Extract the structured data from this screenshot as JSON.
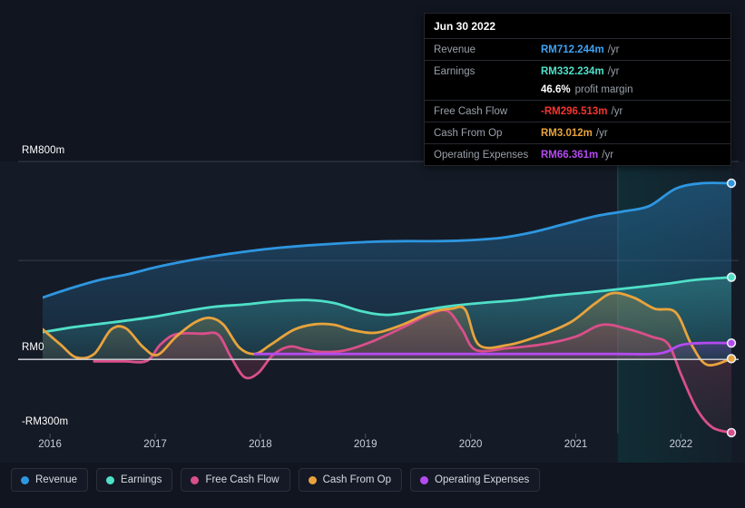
{
  "tooltip": {
    "date": "Jun 30 2022",
    "rows": [
      {
        "key": "Revenue",
        "value": "RM712.244m",
        "unit": "/yr",
        "color": "#3fa3f5"
      },
      {
        "key": "Earnings",
        "value": "RM332.234m",
        "unit": "/yr",
        "color": "#4fe0c8"
      },
      {
        "key": "",
        "value": "46.6%",
        "unit": "",
        "sub": "profit margin",
        "color": "#ffffff"
      },
      {
        "key": "Free Cash Flow",
        "value": "-RM296.513m",
        "unit": "/yr",
        "color": "#f4352e"
      },
      {
        "key": "Cash From Op",
        "value": "RM3.012m",
        "unit": "/yr",
        "color": "#e8a33d"
      },
      {
        "key": "Operating Expenses",
        "value": "RM66.361m",
        "unit": "/yr",
        "color": "#b44bf0"
      }
    ]
  },
  "legend": {
    "items": [
      {
        "label": "Revenue",
        "color": "#2e96e0"
      },
      {
        "label": "Earnings",
        "color": "#4fe0c8"
      },
      {
        "label": "Free Cash Flow",
        "color": "#d94f8a"
      },
      {
        "label": "Cash From Op",
        "color": "#e8a33d"
      },
      {
        "label": "Operating Expenses",
        "color": "#b44bf0"
      }
    ]
  },
  "chart_data": {
    "type": "area",
    "title": "",
    "xlabel": "",
    "ylabel": "",
    "currency": "RM",
    "ylim": [
      -300,
      800
    ],
    "yticks": [
      800,
      400,
      0,
      -300
    ],
    "ytick_labels": [
      "RM800m",
      "",
      "RM0",
      "-RM300m"
    ],
    "grid": true,
    "legend_position": "bottom",
    "x": [
      "2016",
      "2017",
      "2018",
      "2019",
      "2020",
      "2021",
      "2022"
    ],
    "xticks": [
      "2016",
      "2017",
      "2018",
      "2019",
      "2020",
      "2021",
      "2022"
    ],
    "forecast_from": "2021.4",
    "series": [
      {
        "name": "Revenue",
        "color": "#2e96e0",
        "fill": "rgba(38,110,160,0.55)",
        "points": [
          [
            2015.93,
            250
          ],
          [
            2016.2,
            288
          ],
          [
            2016.48,
            322
          ],
          [
            2016.75,
            345
          ],
          [
            2017.0,
            372
          ],
          [
            2017.3,
            398
          ],
          [
            2017.6,
            420
          ],
          [
            2017.9,
            438
          ],
          [
            2018.2,
            452
          ],
          [
            2018.5,
            462
          ],
          [
            2018.8,
            470
          ],
          [
            2019.1,
            476
          ],
          [
            2019.4,
            478
          ],
          [
            2019.7,
            478
          ],
          [
            2020.0,
            482
          ],
          [
            2020.3,
            492
          ],
          [
            2020.6,
            515
          ],
          [
            2020.9,
            548
          ],
          [
            2021.2,
            580
          ],
          [
            2021.45,
            598
          ],
          [
            2021.7,
            620
          ],
          [
            2021.95,
            690
          ],
          [
            2022.2,
            712
          ],
          [
            2022.48,
            712
          ]
        ],
        "end_value": 712.244
      },
      {
        "name": "Earnings",
        "color": "#4fe0c8",
        "fill": "rgba(56,150,150,0.48)",
        "points": [
          [
            2015.93,
            110
          ],
          [
            2016.25,
            132
          ],
          [
            2016.6,
            150
          ],
          [
            2016.95,
            170
          ],
          [
            2017.25,
            192
          ],
          [
            2017.55,
            212
          ],
          [
            2017.85,
            222
          ],
          [
            2018.15,
            235
          ],
          [
            2018.45,
            240
          ],
          [
            2018.7,
            228
          ],
          [
            2018.95,
            196
          ],
          [
            2019.2,
            180
          ],
          [
            2019.5,
            196
          ],
          [
            2019.8,
            215
          ],
          [
            2020.1,
            228
          ],
          [
            2020.45,
            240
          ],
          [
            2020.8,
            258
          ],
          [
            2021.15,
            272
          ],
          [
            2021.5,
            288
          ],
          [
            2021.85,
            305
          ],
          [
            2022.15,
            322
          ],
          [
            2022.48,
            332
          ]
        ],
        "end_value": 332.234
      },
      {
        "name": "Free Cash Flow",
        "color": "#d94f8a",
        "fill": "rgba(150,60,90,0.42)",
        "points": [
          [
            2016.42,
            -8
          ],
          [
            2016.7,
            -8
          ],
          [
            2016.92,
            -6
          ],
          [
            2017.05,
            60
          ],
          [
            2017.2,
            102
          ],
          [
            2017.45,
            104
          ],
          [
            2017.6,
            100
          ],
          [
            2017.72,
            10
          ],
          [
            2017.85,
            -72
          ],
          [
            2017.98,
            -55
          ],
          [
            2018.12,
            18
          ],
          [
            2018.28,
            52
          ],
          [
            2018.42,
            40
          ],
          [
            2018.58,
            30
          ],
          [
            2018.8,
            36
          ],
          [
            2019.05,
            70
          ],
          [
            2019.35,
            128
          ],
          [
            2019.6,
            180
          ],
          [
            2019.78,
            196
          ],
          [
            2019.92,
            120
          ],
          [
            2020.05,
            38
          ],
          [
            2020.35,
            45
          ],
          [
            2020.7,
            62
          ],
          [
            2021.0,
            92
          ],
          [
            2021.25,
            140
          ],
          [
            2021.5,
            122
          ],
          [
            2021.72,
            92
          ],
          [
            2021.88,
            62
          ],
          [
            2022.0,
            -60
          ],
          [
            2022.15,
            -200
          ],
          [
            2022.3,
            -275
          ],
          [
            2022.48,
            -296
          ]
        ],
        "end_value": -296.513
      },
      {
        "name": "Cash From Op",
        "color": "#e8a33d",
        "fill": "rgba(150,125,70,0.40)",
        "points": [
          [
            2015.93,
            122
          ],
          [
            2016.1,
            60
          ],
          [
            2016.25,
            8
          ],
          [
            2016.42,
            22
          ],
          [
            2016.58,
            120
          ],
          [
            2016.72,
            126
          ],
          [
            2016.88,
            52
          ],
          [
            2017.02,
            18
          ],
          [
            2017.2,
            92
          ],
          [
            2017.38,
            150
          ],
          [
            2017.52,
            168
          ],
          [
            2017.65,
            140
          ],
          [
            2017.8,
            48
          ],
          [
            2017.95,
            22
          ],
          [
            2018.1,
            60
          ],
          [
            2018.32,
            120
          ],
          [
            2018.52,
            142
          ],
          [
            2018.7,
            140
          ],
          [
            2018.88,
            118
          ],
          [
            2019.1,
            108
          ],
          [
            2019.35,
            140
          ],
          [
            2019.62,
            190
          ],
          [
            2019.82,
            205
          ],
          [
            2019.95,
            200
          ],
          [
            2020.08,
            58
          ],
          [
            2020.35,
            58
          ],
          [
            2020.65,
            95
          ],
          [
            2020.95,
            150
          ],
          [
            2021.18,
            225
          ],
          [
            2021.35,
            268
          ],
          [
            2021.55,
            250
          ],
          [
            2021.75,
            205
          ],
          [
            2021.95,
            190
          ],
          [
            2022.1,
            60
          ],
          [
            2022.25,
            -22
          ],
          [
            2022.48,
            3
          ]
        ],
        "end_value": 3.012
      },
      {
        "name": "Operating Expenses",
        "color": "#b44bf0",
        "fill": "rgba(110,60,160,0.42)",
        "points": [
          [
            2017.95,
            22
          ],
          [
            2018.4,
            22
          ],
          [
            2019.0,
            22
          ],
          [
            2019.6,
            22
          ],
          [
            2020.2,
            22
          ],
          [
            2020.8,
            22
          ],
          [
            2021.4,
            22
          ],
          [
            2021.8,
            24
          ],
          [
            2022.0,
            58
          ],
          [
            2022.2,
            66
          ],
          [
            2022.48,
            66
          ]
        ],
        "end_value": 66.361
      }
    ]
  },
  "axis": {
    "y_top": "RM800m",
    "y_zero": "RM0",
    "y_bottom": "-RM300m"
  }
}
